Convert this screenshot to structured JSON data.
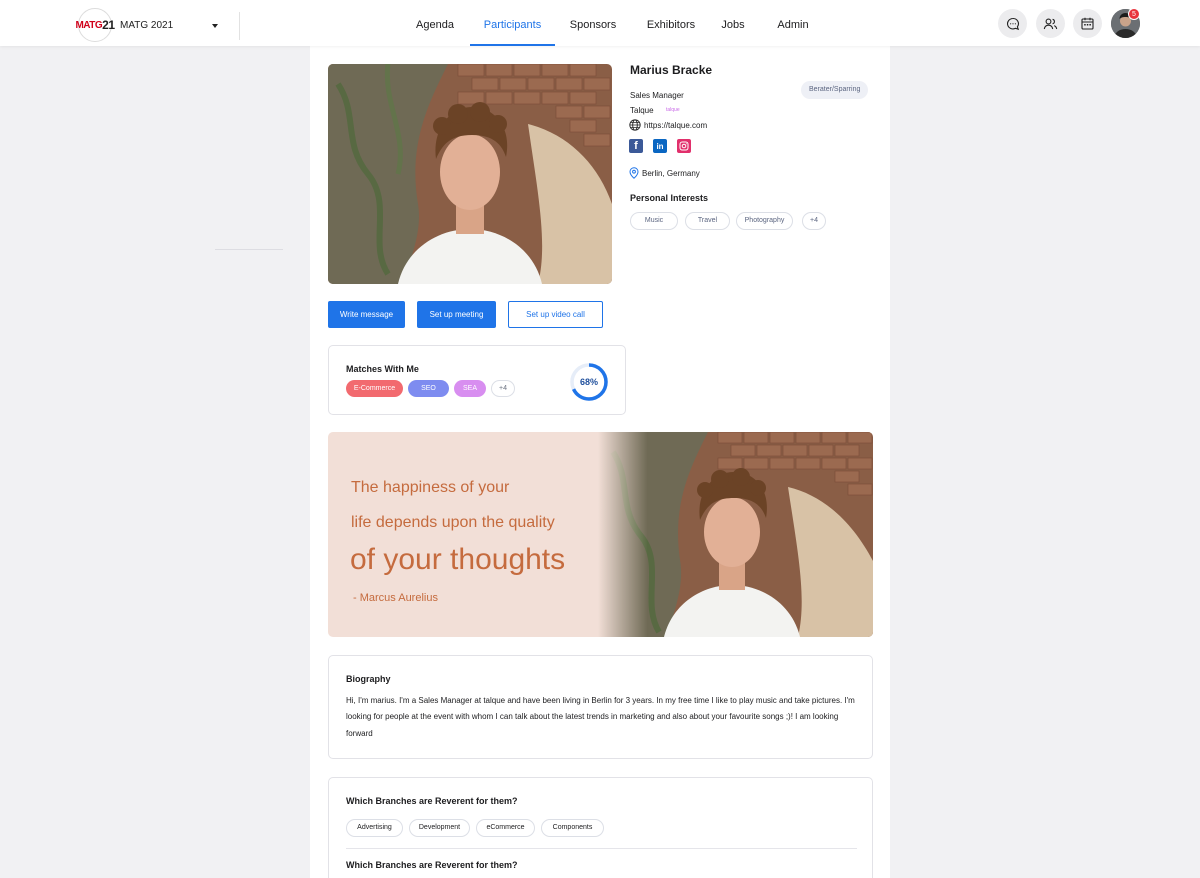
{
  "header": {
    "logo_part1": "MATG",
    "logo_part2": "21",
    "event_name": "MATG 2021",
    "nav": [
      "Agenda",
      "Participants",
      "Sponsors",
      "Exhibitors",
      "Jobs",
      "Admin"
    ],
    "active_nav": "Participants",
    "notification_count": "5",
    "icons": [
      "chat-icon",
      "people-icon",
      "calendar-icon"
    ]
  },
  "profile": {
    "name": "Marius Bracke",
    "tag": "Berater/Sparring",
    "role": "Sales Manager",
    "company": "Talque",
    "company_mark": "talque",
    "website": "https://talque.com",
    "location": "Berlin, Germany",
    "socials": [
      "facebook-icon",
      "linkedin-icon",
      "instagram-icon"
    ],
    "interests_title": "Personal Interests",
    "interests": [
      "Music",
      "Travel",
      "Photography",
      "+4"
    ]
  },
  "actions": {
    "write_message": "Write message",
    "setup_meeting": "Set up meeting",
    "setup_video_call": "Set up video call"
  },
  "matches": {
    "title": "Matches With Me",
    "chips": [
      {
        "label": "E-Commerce",
        "color": "#f26a6f"
      },
      {
        "label": "SEO",
        "color": "#7e8cf0"
      },
      {
        "label": "SEA",
        "color": "#d88ef0"
      }
    ],
    "more": "+4",
    "percent_label": "68%",
    "percent": 68,
    "ring_color": "#1f74e8"
  },
  "quote": {
    "line1": "The happiness of your",
    "line2": "life depends upon the quality",
    "line3": "of your thoughts",
    "author": "- Marcus Aurelius"
  },
  "biography": {
    "title": "Biography",
    "text": "Hi, I'm marius. I'm a Sales Manager at talque and have been living in Berlin for 3 years. In my free time I like to play music and take pictures. I'm looking for people at the event with whom I can talk about the latest trends in marketing and also about your favourite songs ;)! I am looking forward"
  },
  "branches": {
    "title1": "Which Branches are Reverent for them?",
    "chips": [
      "Advertising",
      "Development",
      "eCommerce",
      "Components"
    ],
    "title2": "Which Branches are Reverent for them?"
  },
  "colors": {
    "accent": "#1f74e8",
    "quote_text": "#c56b3e",
    "quote_bg": "#f2dfd7"
  }
}
